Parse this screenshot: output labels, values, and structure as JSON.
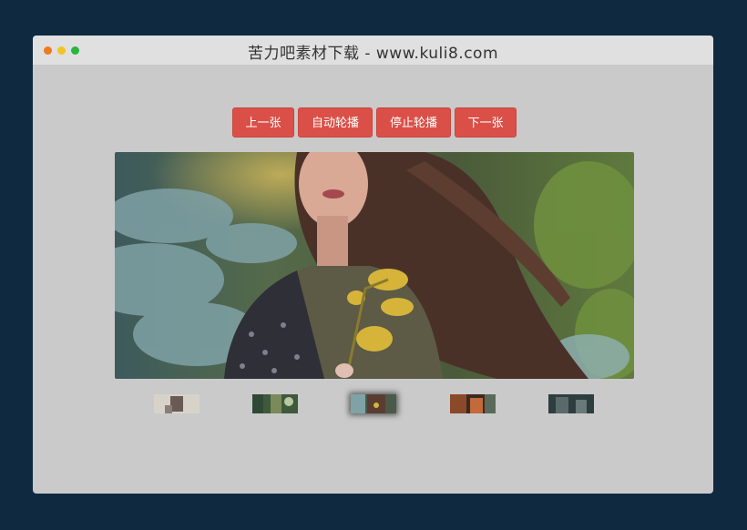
{
  "window": {
    "title": "苦力吧素材下载 - www.kuli8.com",
    "traffic_lights": [
      "#f0791f",
      "#f2c521",
      "#28b63e"
    ]
  },
  "controls": {
    "prev_label": "上一张",
    "autoplay_label": "自动轮播",
    "stop_label": "停止轮播",
    "next_label": "下一张",
    "button_color": "#da5048"
  },
  "slider": {
    "active_index": 3,
    "thumbnail_count": 5
  }
}
